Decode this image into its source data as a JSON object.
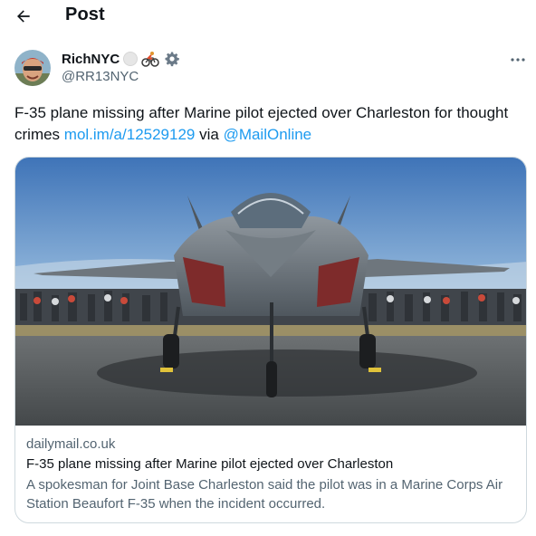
{
  "header": {
    "title": "Post"
  },
  "author": {
    "display_name": "RichNYC",
    "handle": "@RR13NYC"
  },
  "tweet": {
    "text_before": "F-35 plane missing after Marine pilot ejected over Charleston for thought crimes ",
    "link": "mol.im/a/12529129",
    "text_middle": " via ",
    "mention": "@MailOnline"
  },
  "card": {
    "domain": "dailymail.co.uk",
    "title": "F-35 plane missing after Marine pilot ejected over Charleston",
    "description": "A spokesman for Joint Base Charleston said the pilot was in a Marine Corps Air Station Beaufort F-35 when the incident occurred."
  },
  "icons": {
    "back": "back-arrow-icon",
    "more": "more-icon",
    "badges": [
      "grey-circle-icon",
      "cyclist-icon",
      "gear-icon"
    ]
  }
}
